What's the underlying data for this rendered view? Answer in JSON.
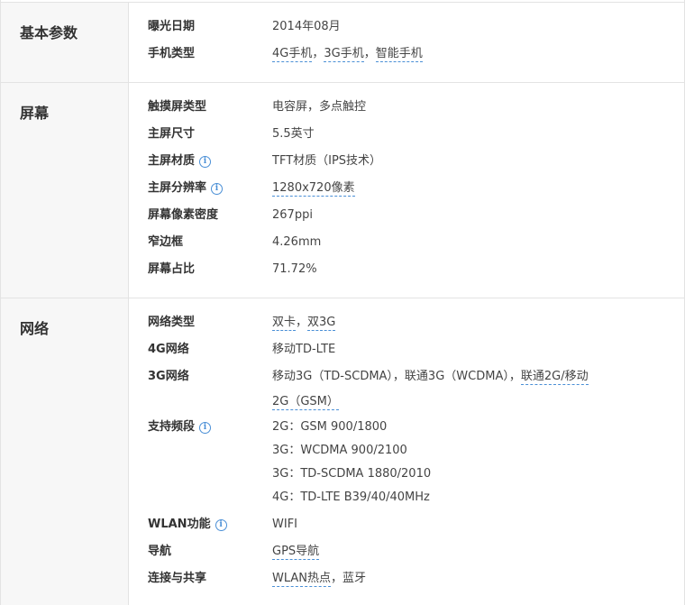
{
  "sections": [
    {
      "name": "基本参数",
      "rows": [
        {
          "label": "曝光日期",
          "value_parts": [
            {
              "text": "2014年08月"
            }
          ]
        },
        {
          "label": "手机类型",
          "value_parts": [
            {
              "text": "4G手机",
              "link": true
            },
            {
              "text": "，"
            },
            {
              "text": "3G手机",
              "link": true
            },
            {
              "text": "，"
            },
            {
              "text": "智能手机",
              "link": true
            }
          ]
        }
      ]
    },
    {
      "name": "屏幕",
      "rows": [
        {
          "label": "触摸屏类型",
          "value_parts": [
            {
              "text": "电容屏，多点触控"
            }
          ]
        },
        {
          "label": "主屏尺寸",
          "value_parts": [
            {
              "text": "5.5英寸"
            }
          ]
        },
        {
          "label": "主屏材质",
          "info": true,
          "value_parts": [
            {
              "text": "TFT材质（IPS技术）"
            }
          ]
        },
        {
          "label": "主屏分辨率",
          "info": true,
          "value_parts": [
            {
              "text": "1280x720像素",
              "link": true
            }
          ]
        },
        {
          "label": "屏幕像素密度",
          "value_parts": [
            {
              "text": "267ppi"
            }
          ]
        },
        {
          "label": "窄边框",
          "value_parts": [
            {
              "text": "4.26mm"
            }
          ]
        },
        {
          "label": "屏幕占比",
          "value_parts": [
            {
              "text": "71.72%"
            }
          ]
        }
      ]
    },
    {
      "name": "网络",
      "rows": [
        {
          "label": "网络类型",
          "value_parts": [
            {
              "text": "双卡",
              "link": true
            },
            {
              "text": "，"
            },
            {
              "text": "双3G",
              "link": true
            }
          ]
        },
        {
          "label": "4G网络",
          "value_parts": [
            {
              "text": "移动TD-LTE"
            }
          ]
        },
        {
          "label": "3G网络",
          "value_parts": [
            {
              "text": "移动3G（TD-SCDMA），联通3G（WCDMA），"
            },
            {
              "text": "联通2G/移动",
              "link": true
            }
          ],
          "value_line2_parts": [
            {
              "text": "2G（GSM）",
              "link": true
            }
          ]
        },
        {
          "label": "支持频段",
          "info": true,
          "value_lines": [
            "2G：GSM 900/1800",
            "3G：WCDMA 900/2100",
            "3G：TD-SCDMA 1880/2010",
            "4G：TD-LTE B39/40/40MHz"
          ]
        },
        {
          "label": "WLAN功能",
          "info": true,
          "value_parts": [
            {
              "text": "WIFI"
            }
          ]
        },
        {
          "label": "导航",
          "value_parts": [
            {
              "text": "GPS导航",
              "link": true
            }
          ]
        },
        {
          "label": "连接与共享",
          "value_parts": [
            {
              "text": "WLAN热点",
              "link": true
            },
            {
              "text": "，蓝牙"
            }
          ]
        }
      ]
    }
  ]
}
